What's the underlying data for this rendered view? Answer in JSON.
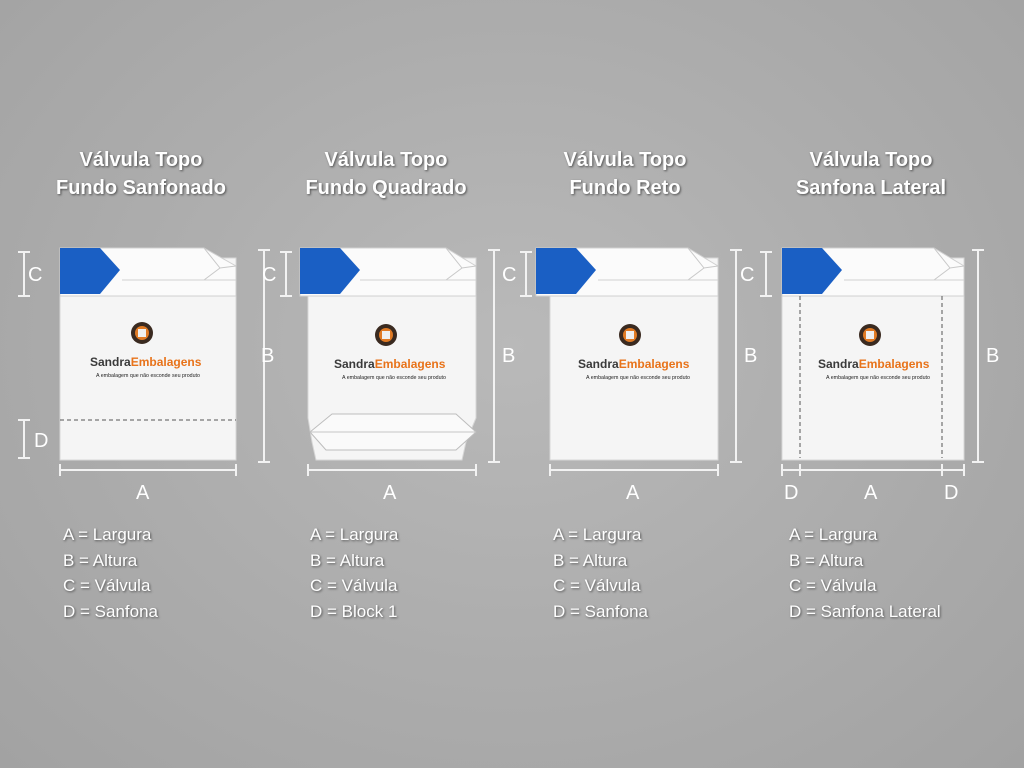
{
  "colors": {
    "background": "#acacac",
    "valve_blue": "#1a5fc4",
    "bag_white": "#f7f7f7",
    "brand_dark": "#3a3a3a",
    "brand_orange": "#e8731a"
  },
  "brand": {
    "name_part1": "Sandra",
    "name_part2": "Embalagens",
    "tagline": "A embalagem que não esconde seu produto"
  },
  "panels": [
    {
      "title_line1": "Válvula Topo",
      "title_line2": "Fundo Sanfonado",
      "dims": {
        "a": "A",
        "b": "B",
        "c": "C",
        "d": "D",
        "d_right": ""
      },
      "legend": [
        "A = Largura",
        "B = Altura",
        "C = Válvula",
        "D = Sanfona"
      ]
    },
    {
      "title_line1": "Válvula Topo",
      "title_line2": "Fundo Quadrado",
      "dims": {
        "a": "A",
        "b": "B",
        "c": "C",
        "d": "",
        "d_right": ""
      },
      "legend": [
        "A = Largura",
        "B = Altura",
        "C = Válvula",
        "D = Block 1"
      ]
    },
    {
      "title_line1": "Válvula Topo",
      "title_line2": "Fundo Reto",
      "dims": {
        "a": "A",
        "b": "B",
        "c": "C",
        "d": "",
        "d_right": ""
      },
      "legend": [
        "A = Largura",
        "B = Altura",
        "C = Válvula",
        "D = Sanfona"
      ]
    },
    {
      "title_line1": "Válvula Topo",
      "title_line2": "Sanfona Lateral",
      "dims": {
        "a": "A",
        "b": "B",
        "c": "C",
        "d": "D",
        "d_right": "D"
      },
      "legend": [
        "A = Largura",
        "B = Altura",
        "C = Válvula",
        "D = Sanfona Lateral"
      ]
    }
  ]
}
